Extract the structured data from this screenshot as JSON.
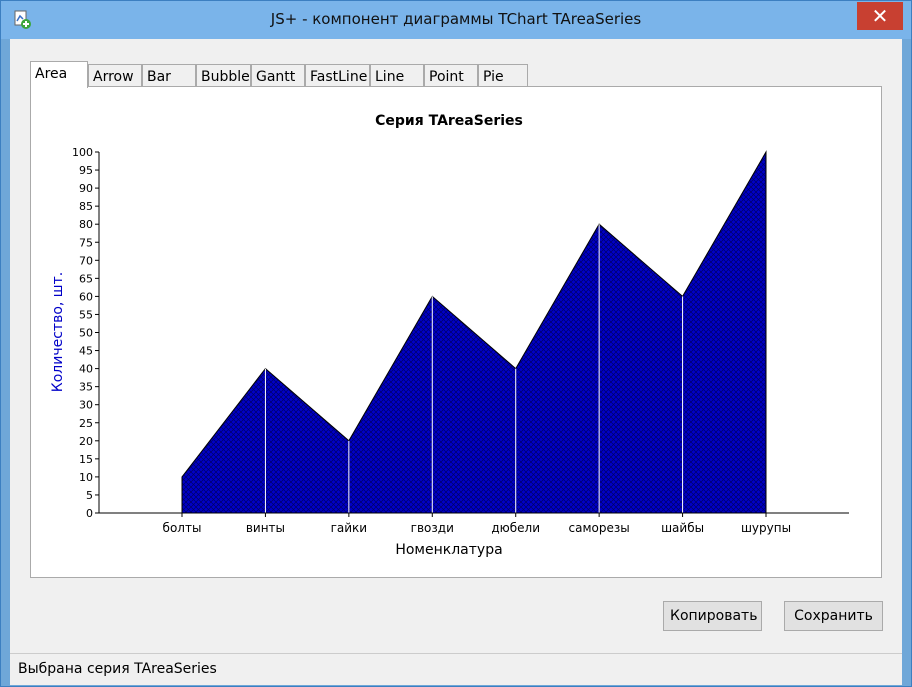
{
  "window": {
    "title": "JS+ - компонент диаграммы TChart TAreaSeries",
    "close_label": "✕"
  },
  "tabs": [
    {
      "label": "Area",
      "active": true
    },
    {
      "label": "Arrow"
    },
    {
      "label": "Bar"
    },
    {
      "label": "Bubble"
    },
    {
      "label": "Gantt"
    },
    {
      "label": "FastLine"
    },
    {
      "label": "Line"
    },
    {
      "label": "Point"
    },
    {
      "label": "Pie"
    }
  ],
  "chart_data": {
    "type": "area",
    "title": "Серия TAreaSeries",
    "xlabel": "Номенклатура",
    "ylabel": "Количество, шт.",
    "categories": [
      "болты",
      "винты",
      "гайки",
      "гвозди",
      "дюбели",
      "саморезы",
      "шайбы",
      "шурупы"
    ],
    "values": [
      10,
      40,
      20,
      60,
      40,
      80,
      60,
      100
    ],
    "ylim": [
      0,
      100
    ],
    "yticks": [
      0,
      5,
      10,
      15,
      20,
      25,
      30,
      35,
      40,
      45,
      50,
      55,
      60,
      65,
      70,
      75,
      80,
      85,
      90,
      95,
      100
    ],
    "fill_color": "#0000c8",
    "ylabel_color": "#0000c8",
    "legend": "none",
    "grid": false
  },
  "buttons": {
    "copy_label": "Копировать",
    "save_label": "Сохранить"
  },
  "status": {
    "text": "Выбрана серия TAreaSeries"
  }
}
